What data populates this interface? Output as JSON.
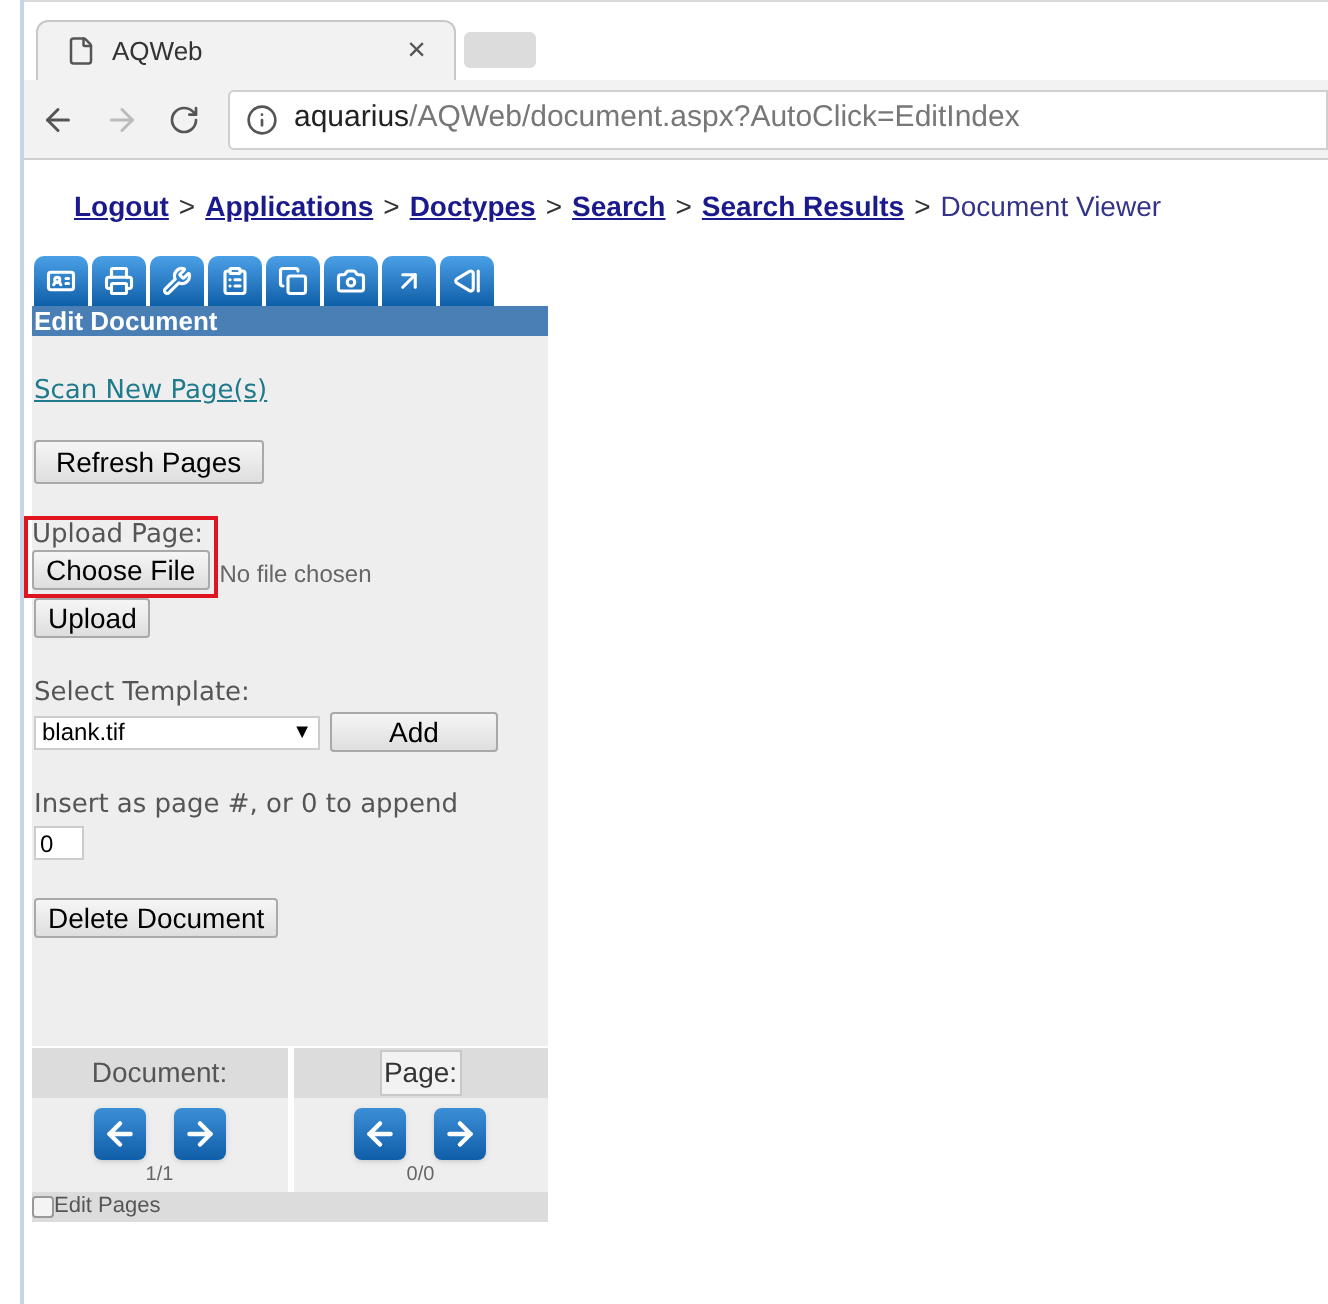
{
  "browser": {
    "tab_title": "AQWeb",
    "tab_close": "×",
    "url_host": "aquarius",
    "url_path": "/AQWeb/document.aspx?AutoClick=EditIndex"
  },
  "breadcrumb": [
    {
      "label": "Logout",
      "kind": "link"
    },
    {
      "label": ">",
      "kind": "sep"
    },
    {
      "label": "Applications",
      "kind": "link"
    },
    {
      "label": ">",
      "kind": "sep"
    },
    {
      "label": "Doctypes",
      "kind": "link"
    },
    {
      "label": ">",
      "kind": "sep"
    },
    {
      "label": "Search",
      "kind": "link"
    },
    {
      "label": ">",
      "kind": "sep"
    },
    {
      "label": "Search Results",
      "kind": "link"
    },
    {
      "label": ">",
      "kind": "sep"
    },
    {
      "label": "Document Viewer",
      "kind": "current"
    }
  ],
  "panel": {
    "title": "Edit Document",
    "scan_link": "Scan New Page(s)",
    "refresh_button": "Refresh Pages",
    "upload_label": "Upload Page:",
    "choose_file_button": "Choose File",
    "no_file": "No file chosen",
    "upload_button": "Upload",
    "template_label": "Select Template:",
    "template_value": "blank.tif",
    "template_caret": "▼",
    "add_button": "Add",
    "insert_label": "Insert as page #, or 0 to append",
    "insert_value": "0",
    "delete_button": "Delete Document"
  },
  "navigator": [
    {
      "heading": "Document:",
      "kind": "plain",
      "counter": "1/1"
    },
    {
      "heading": "Page:",
      "kind": "button",
      "counter": "0/0"
    }
  ],
  "edit_pages": {
    "label": "Edit Pages",
    "checked": false
  }
}
